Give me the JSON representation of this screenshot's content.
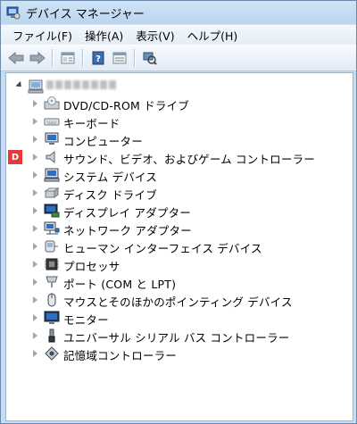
{
  "window": {
    "title": "デバイス マネージャー"
  },
  "menu": [
    {
      "label": "ファイル(F)"
    },
    {
      "label": "操作(A)"
    },
    {
      "label": "表示(V)"
    },
    {
      "label": "ヘルプ(H)"
    }
  ],
  "toolbar": {
    "icons": [
      "back-arrow-icon",
      "forward-arrow-icon",
      "properties-sheet-icon",
      "help-icon",
      "device-list-icon",
      "scan-hardware-icon"
    ]
  },
  "tree": {
    "categories": [
      {
        "label": "DVD/CD-ROM ドライブ",
        "icon": "dvd-drive-icon"
      },
      {
        "label": "キーボード",
        "icon": "keyboard-icon"
      },
      {
        "label": "コンピューター",
        "icon": "computer-icon"
      },
      {
        "label": "サウンド、ビデオ、およびゲーム コントローラー",
        "icon": "speaker-icon",
        "marker": "D"
      },
      {
        "label": "システム デバイス",
        "icon": "system-devices-icon"
      },
      {
        "label": "ディスク ドライブ",
        "icon": "disk-drive-icon"
      },
      {
        "label": "ディスプレイ アダプター",
        "icon": "display-adapter-icon"
      },
      {
        "label": "ネットワーク アダプター",
        "icon": "network-adapter-icon"
      },
      {
        "label": "ヒューマン インターフェイス デバイス",
        "icon": "hid-icon"
      },
      {
        "label": "プロセッサ",
        "icon": "processor-icon"
      },
      {
        "label": "ポート (COM と LPT)",
        "icon": "port-icon"
      },
      {
        "label": "マウスとそのほかのポインティング デバイス",
        "icon": "mouse-icon"
      },
      {
        "label": "モニター",
        "icon": "monitor-icon"
      },
      {
        "label": "ユニバーサル シリアル バス コントローラー",
        "icon": "usb-icon"
      },
      {
        "label": "記憶域コントローラー",
        "icon": "storage-controller-icon"
      }
    ]
  }
}
